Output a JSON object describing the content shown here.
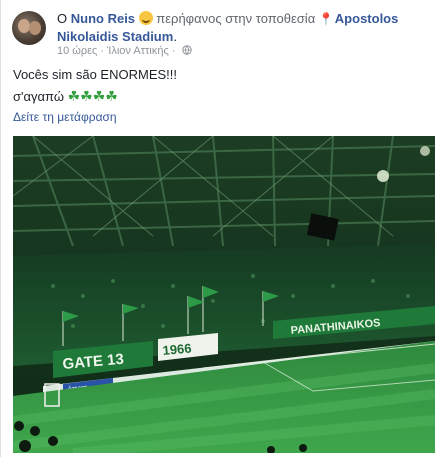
{
  "post": {
    "author": "Nuno Reis",
    "prefix": "O",
    "feeling_text": "περήφανος στην τοποθεσία",
    "location_line1": "Apostolos",
    "location_line2": "Nikolaidis Stadium",
    "location_suffix": ".",
    "time": "10 ώρες",
    "place_meta": "Ίλιον Αττικής",
    "separator": "·",
    "message_line1": "Vocês sim são ENORMES!!!",
    "message_line2": "σ'αγαπώ",
    "clovers": "☘☘☘☘",
    "see_translation": "Δείτε τη μετάφραση"
  },
  "photo": {
    "banner_main": "PANATHINAIKOS",
    "banner_gate": "GATE 13",
    "banner_year": "1966",
    "sponsor": "όπαπ",
    "colors": {
      "green": "#1f7a3a",
      "dark": "#0c2616",
      "link": "#365899"
    }
  },
  "icons": [
    "smile-emoji-icon",
    "location-pin-icon",
    "globe-icon",
    "shamrock-icon"
  ]
}
